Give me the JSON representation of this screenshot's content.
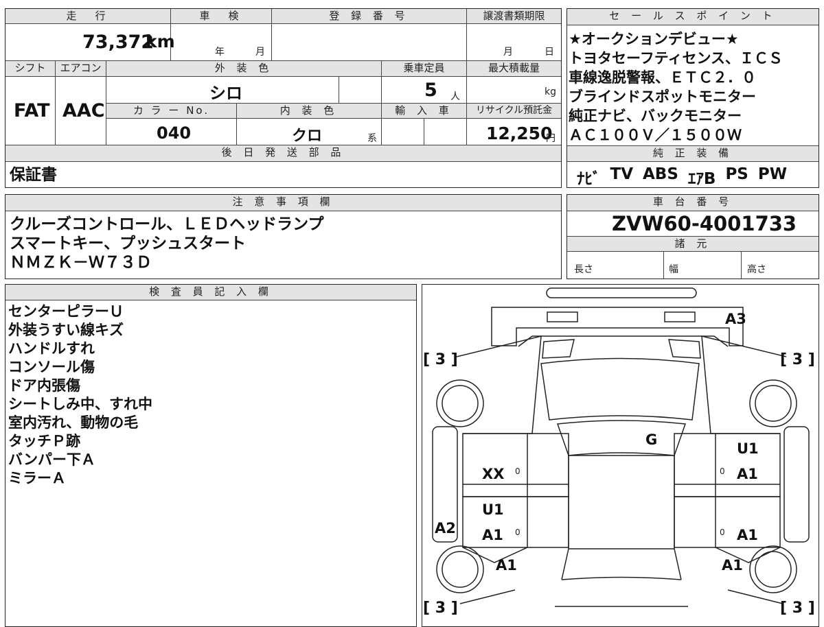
{
  "top_table": {
    "mileage_label": "走　行",
    "mileage_value": "73,372",
    "mileage_unit": "km",
    "inspection_label": "車　検",
    "inspection_year": "年",
    "inspection_month": "月",
    "registration_label": "登 録 番 号",
    "transfer_label": "譲渡書類期限",
    "transfer_month": "月",
    "transfer_day": "日",
    "shift_label": "シフト",
    "aircon_label": "エアコン",
    "exterior_color_label": "外 装 色",
    "capacity_label": "乗車定員",
    "max_load_label": "最大積載量",
    "shift_value": "FAT",
    "aircon_value": "AAC",
    "exterior_color_value": "シロ",
    "capacity_value": "5",
    "capacity_unit": "人",
    "max_load_unit": "kg",
    "color_no_label": "カ ラ ー No.",
    "interior_color_label": "内 装 色",
    "import_label": "輸 入 車",
    "recycle_label": "リサイクル預託金",
    "color_no_value": "040",
    "interior_color_value": "クロ",
    "interior_color_suffix": "系",
    "recycle_value": "12,250",
    "recycle_unit": "円"
  },
  "parts": {
    "label": "後 日 発 送 部 品",
    "value": "保証書"
  },
  "notes": {
    "label": "注 意 事 項 欄",
    "lines": [
      "クルーズコントロール、ＬＥＤヘッドランプ",
      "スマートキー、プッシュスタート",
      "ＮＭＺＫ－Ｗ７３Ｄ"
    ]
  },
  "sales_points": {
    "label": "セ ー ル ス ポ イ ン ト",
    "lines": [
      "★オークションデビュー★",
      "トヨタセーフティセンス、ＩＣＳ",
      "車線逸脱警報、ＥＴＣ２．０",
      "ブラインドスポットモニター",
      "純正ナビ、バックモニター",
      "ＡＣ１００Ｖ／１５００Ｗ"
    ]
  },
  "equipment": {
    "label": "純 正 装 備",
    "items": [
      "ﾅﾋﾞ",
      "TV",
      "ABS",
      "ｴｱB",
      "PS",
      "PW"
    ]
  },
  "chassis": {
    "label": "車 台 番 号",
    "value": "ZVW60-4001733"
  },
  "specs": {
    "label": "諸 元",
    "length_label": "長さ",
    "width_label": "幅",
    "height_label": "高さ"
  },
  "inspector": {
    "label": "検 査 員 記 入 欄",
    "lines": [
      "センターピラーＵ",
      "外装うすい線キズ",
      "ハンドルすれ",
      "コンソール傷",
      "ドア内張傷",
      "シートしみ中、すれ中",
      "室内汚れ、動物の毛",
      "タッチＰ跡",
      "バンパー下Ａ",
      "ミラーＡ"
    ]
  },
  "diagram": {
    "rear_bumper": "A3",
    "roof": "G",
    "tire_rear_left": "3",
    "tire_rear_right": "3",
    "tire_front_left": "3",
    "tire_front_right": "3",
    "rear_left_door": "XX",
    "rear_right_door_1": "U1",
    "rear_right_door_2": "A1",
    "front_left_door_1": "U1",
    "front_left_door_2": "A1",
    "front_right_door": "A1",
    "left_sill": "A2",
    "front_left_fender": "A1",
    "front_right_fender": "A1",
    "zero_mark": "0"
  }
}
